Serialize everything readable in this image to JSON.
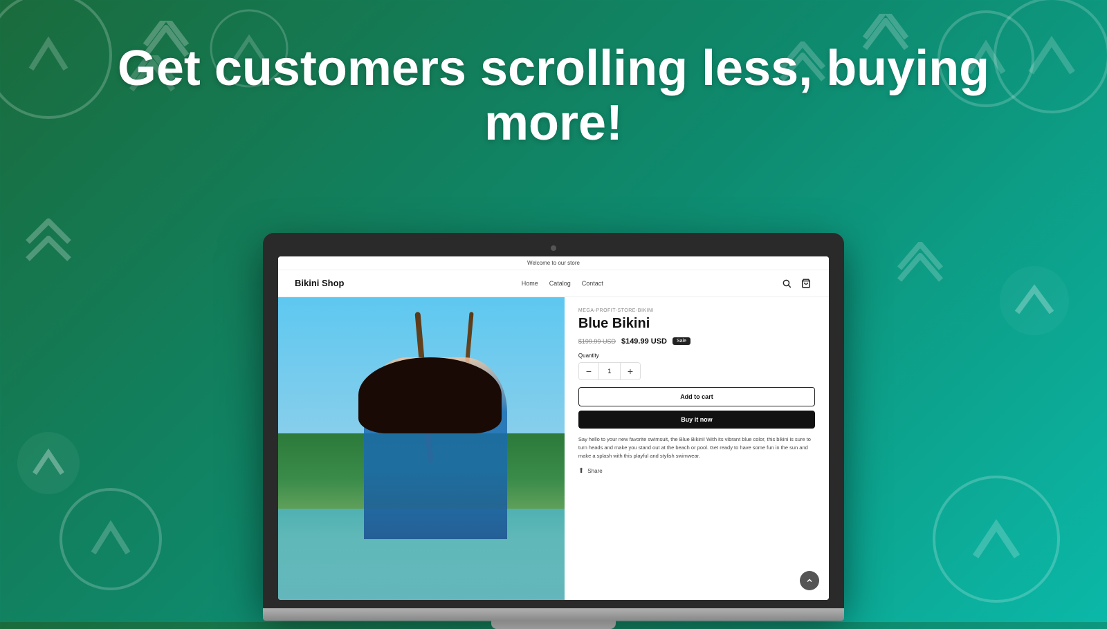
{
  "headline": "Get customers scrolling less, buying more!",
  "background": {
    "gradient_start": "#1a6b3c",
    "gradient_end": "#0bb8a8"
  },
  "store": {
    "top_bar": "Welcome to our store",
    "logo": "Bikini Shop",
    "nav": [
      "Home",
      "Catalog",
      "Contact"
    ],
    "product": {
      "vendor": "MEGA-PROFIT-STORE-BIKINI",
      "title": "Blue Bikini",
      "price_original": "$199.99 USD",
      "price_sale": "$149.99 USD",
      "sale_badge": "Sale",
      "quantity_label": "Quantity",
      "quantity_value": "1",
      "btn_add_to_cart": "Add to cart",
      "btn_buy_now": "Buy it now",
      "description": "Say hello to your new favorite swimsuit, the Blue Bikini! With its vibrant blue color, this bikini is sure to turn heads and make you stand out at the beach or pool. Get ready to have some fun in the sun and make a splash with this playful and stylish swimwear.",
      "share_label": "Share"
    }
  }
}
